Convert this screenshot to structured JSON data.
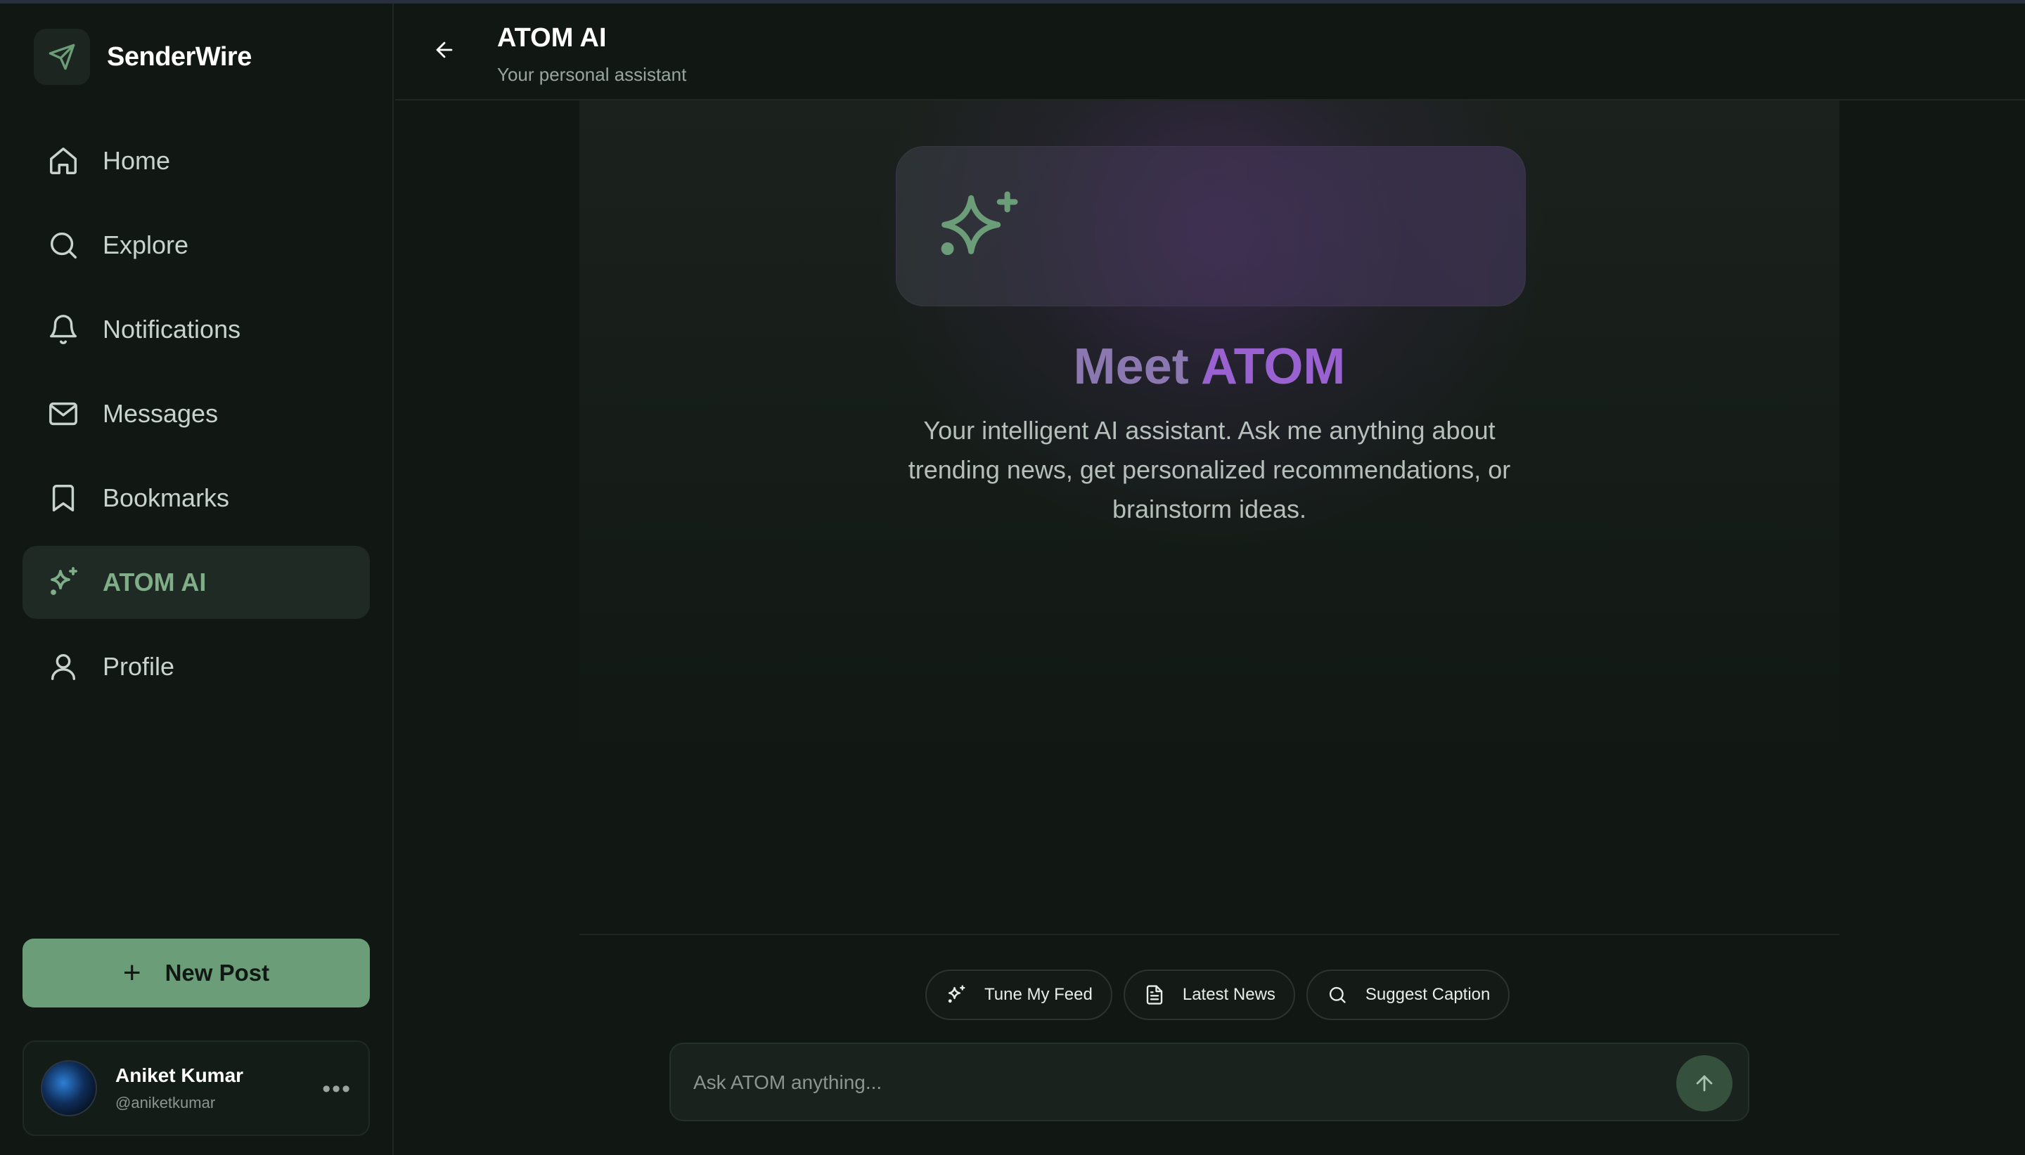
{
  "app": {
    "name": "SenderWire",
    "logo_icon": "paper-plane-icon",
    "accent": "#6b9e78"
  },
  "sidebar": {
    "items": [
      {
        "label": "Home",
        "icon": "home-icon",
        "active": false
      },
      {
        "label": "Explore",
        "icon": "search-icon",
        "active": false
      },
      {
        "label": "Notifications",
        "icon": "bell-icon",
        "active": false
      },
      {
        "label": "Messages",
        "icon": "mail-icon",
        "active": false
      },
      {
        "label": "Bookmarks",
        "icon": "bookmark-icon",
        "active": false
      },
      {
        "label": "ATOM AI",
        "icon": "sparkles-icon",
        "active": true
      },
      {
        "label": "Profile",
        "icon": "user-icon",
        "active": false
      }
    ],
    "new_post_label": "New Post",
    "user": {
      "name": "Aniket Kumar",
      "handle": "@aniketkumar"
    }
  },
  "header": {
    "title": "ATOM AI",
    "subtitle": "Your personal assistant"
  },
  "hero": {
    "title_part1": "Meet ",
    "title_part2": "ATOM",
    "description": "Your intelligent AI assistant. Ask me anything about trending news, get personalized recommendations, or brainstorm ideas."
  },
  "suggestions": [
    {
      "label": "Tune My Feed",
      "icon": "sparkles-icon"
    },
    {
      "label": "Latest News",
      "icon": "document-icon"
    },
    {
      "label": "Suggest Caption",
      "icon": "search-icon"
    }
  ],
  "chat": {
    "placeholder": "Ask ATOM anything..."
  }
}
